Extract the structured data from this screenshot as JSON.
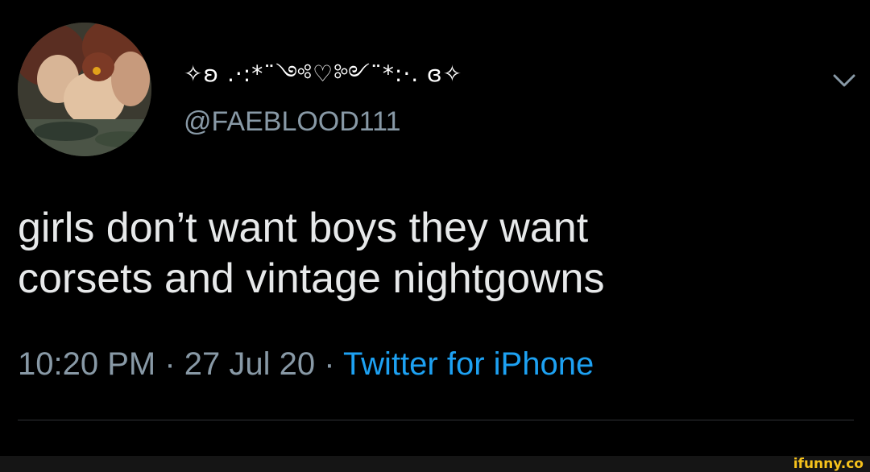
{
  "tweet": {
    "display_name": "✧ʚ .·:*¨༺♡༻¨*:·. ɞ✧",
    "handle": "@FAEBLOOD111",
    "text_line1": "girls don’t want boys they want",
    "text_line2": "corsets and vintage nightgowns",
    "time": "10:20 PM",
    "separator": " · ",
    "date": "27 Jul 20",
    "source": "Twitter for iPhone",
    "avatar_icon": "painting-avatar-icon",
    "more_icon": "chevron-down-icon"
  },
  "watermark": {
    "text": "ifunny.co"
  },
  "colors": {
    "background": "#000000",
    "text": "#e7e9ea",
    "muted": "#8899a6",
    "link": "#1da1f2",
    "watermark": "#f6c21c"
  }
}
